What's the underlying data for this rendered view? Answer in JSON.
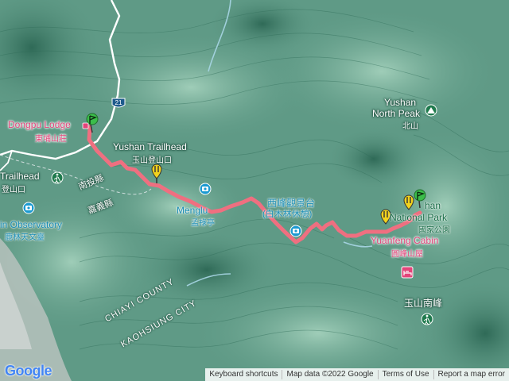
{
  "map": {
    "places": [
      {
        "id": "dongpu-en",
        "text": "Dongpu Lodge"
      },
      {
        "id": "dongpu-zh",
        "text": "東埔山莊"
      },
      {
        "id": "trailhead-en",
        "text": "Yushan Trailhead"
      },
      {
        "id": "trailhead-zh",
        "text": "玉山登山口"
      },
      {
        "id": "trailhead-left-en",
        "text": "Trailhead"
      },
      {
        "id": "trailhead-left-zh",
        "text": "登山口"
      },
      {
        "id": "observatory-en",
        "text": "in Observatory"
      },
      {
        "id": "observatory-zh",
        "text": "鹿林天文臺"
      },
      {
        "id": "mengludi-en",
        "text": "Menglu"
      },
      {
        "id": "mengludi-zh",
        "text": "孟祿亭"
      },
      {
        "id": "xifeng-zh",
        "text": "西峰觀景台"
      },
      {
        "id": "xifeng-zh2",
        "text": "(白木林休憩)"
      },
      {
        "id": "north-peak-en1",
        "text": "Yushan"
      },
      {
        "id": "north-peak-en2",
        "text": "North Peak"
      },
      {
        "id": "north-peak-zh",
        "text": "北山"
      },
      {
        "id": "park-en1",
        "text": "han"
      },
      {
        "id": "park-en2",
        "text": "National Park"
      },
      {
        "id": "park-zh",
        "text": "國家公園"
      },
      {
        "id": "yuanfeng-en",
        "text": "Yuanfeng Cabin"
      },
      {
        "id": "yuanfeng-zh",
        "text": "圓峰山屋"
      },
      {
        "id": "south-peak-zh",
        "text": "玉山南峰"
      },
      {
        "id": "nantou-zh",
        "text": "南投縣"
      },
      {
        "id": "chiayi-zh",
        "text": "嘉義縣"
      },
      {
        "id": "chiayi-en",
        "text": "CHIAYI COUNTY"
      },
      {
        "id": "kaohsiung-en",
        "text": "KAOHSIUNG CITY"
      },
      {
        "id": "road-21",
        "text": "21"
      }
    ]
  },
  "footer": {
    "logo": "Google",
    "keyboard": "Keyboard shortcuts",
    "mapdata": "Map data ©2022 Google",
    "terms": "Terms of Use",
    "report": "Report a map error"
  },
  "colors": {
    "terrain": "#5f9a86",
    "trail": "#ef6f80",
    "pink_label": "#e3447a",
    "marker_yellow": "#f1d21d",
    "marker_green": "#3bbd4a"
  }
}
